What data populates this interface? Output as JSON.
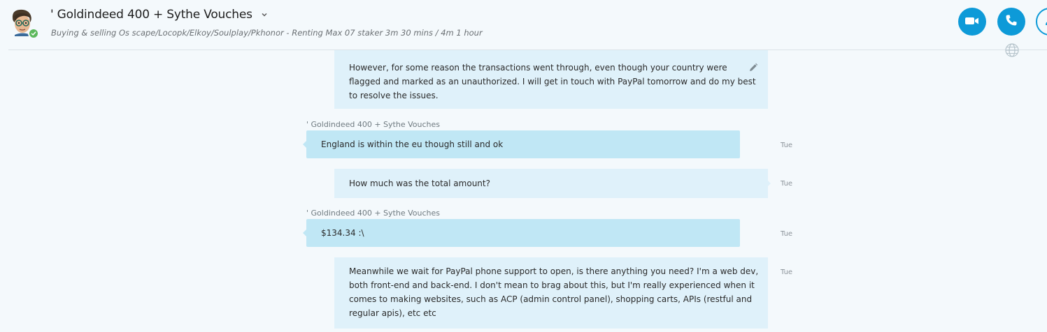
{
  "header": {
    "title": "' Goldindeed 400 + Sythe Vouches",
    "subtitle": "Buying & selling Os scape/Locopk/Elkoy/Soulplay/Pkhonor - Renting Max 07 staker 3m 30 mins / 4m 1 hour",
    "presence": "online",
    "buttons": {
      "video": "video-call",
      "call": "audio-call",
      "profile": "profile"
    }
  },
  "colors": {
    "accent": "#0d9ad8",
    "outgoing_bubble": "#dff1fa",
    "incoming_bubble": "#c0e7f5",
    "presence_online": "#5cb85c"
  },
  "messages": [
    {
      "direction": "outgoing",
      "lines": [
        "However, for some reason the transactions went through, even though your country were",
        "flagged and marked as an unauthorized. I will get in touch with PayPal tomorrow and do my best",
        "to resolve the issues."
      ],
      "edited": true
    },
    {
      "direction": "incoming",
      "sender": "' Goldindeed 400 + Sythe Vouches",
      "text": "England is within the eu though still and ok",
      "time": "Tue"
    },
    {
      "direction": "outgoing",
      "text": "How much was the total amount?",
      "time": "Tue"
    },
    {
      "direction": "incoming",
      "sender": "' Goldindeed 400 + Sythe Vouches",
      "text": "$134.34 :\\",
      "time": "Tue"
    },
    {
      "direction": "outgoing",
      "lines": [
        "Meanwhile we wait for PayPal phone support to open, is there anything you need? I'm a web dev,",
        "both front-end and back-end. I don't mean to brag about this, but I'm really experienced when it",
        "comes to making websites, such as ACP (admin control panel), shopping carts, APIs (restful and",
        "regular apis), etc etc"
      ],
      "time": "Tue"
    }
  ]
}
